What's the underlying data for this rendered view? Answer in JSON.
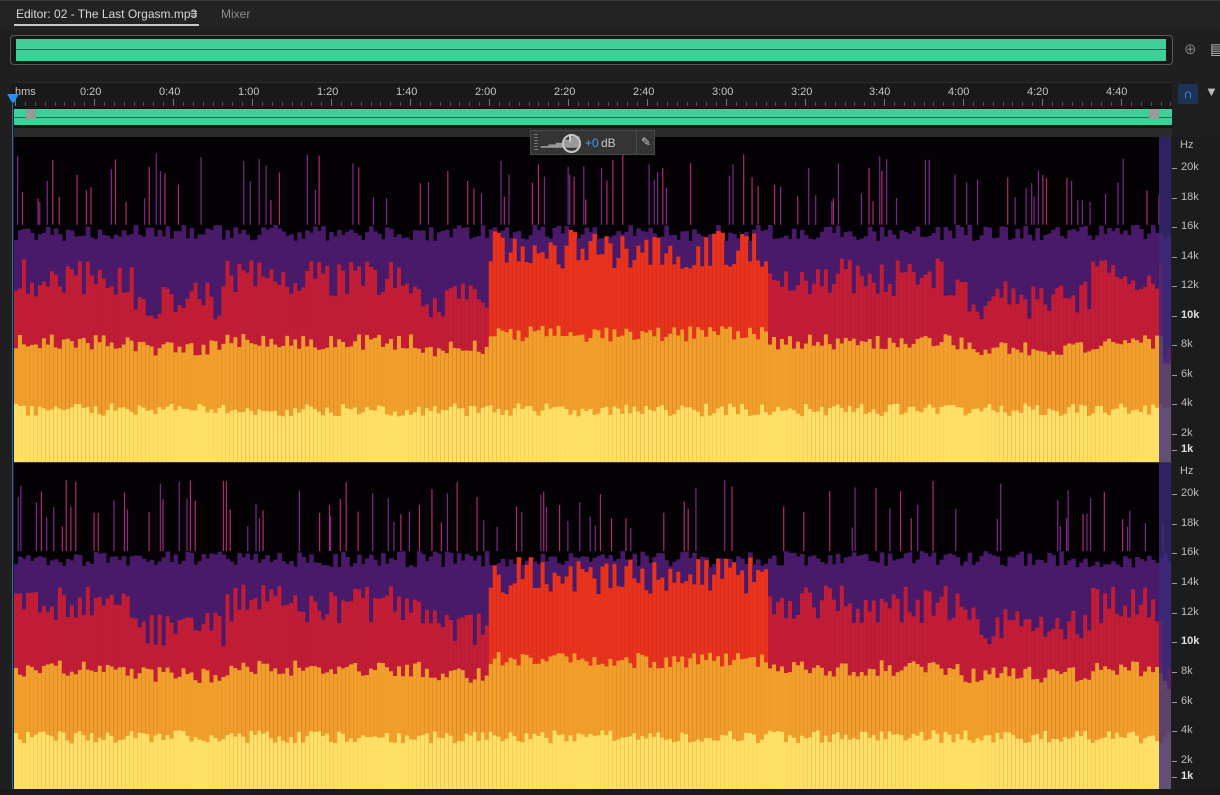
{
  "tabs": {
    "editor_label": "Editor: 02 - The Last Orgasm.mp3",
    "menu_icon": "hamburger-menu-icon",
    "mixer_label": "Mixer"
  },
  "ruler": {
    "unit_label": "hms",
    "ticks": [
      "0:20",
      "0:40",
      "1:00",
      "1:20",
      "1:40",
      "2:00",
      "2:20",
      "2:40",
      "3:00",
      "3:20",
      "3:40",
      "4:00",
      "4:20",
      "4:40"
    ]
  },
  "hud": {
    "value": "+0",
    "unit": "dB"
  },
  "frequency_axis": {
    "unit": "Hz",
    "labels": [
      "20k",
      "18k",
      "16k",
      "14k",
      "12k",
      "10k",
      "8k",
      "6k",
      "4k",
      "2k",
      "1k"
    ]
  },
  "colors": {
    "waveform": "#3fd09a",
    "playhead": "#2a8df0",
    "hud_value": "#3f9bff",
    "spectrum_low": "#ffe066",
    "spectrum_mid": "#e8321b",
    "spectrum_high": "#4a1a6a"
  },
  "icons": {
    "zoom_icon": "zoom-icon",
    "panel_icon": "panel-toggle-icon",
    "snap_icon": "snap-magnet-icon",
    "marker_icon": "marker-pin-icon",
    "pin_icon": "pin-icon"
  }
}
